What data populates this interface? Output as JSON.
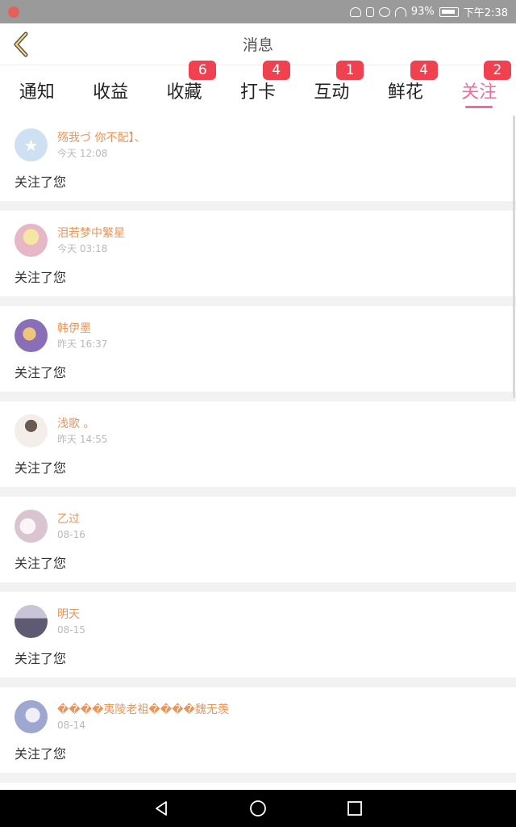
{
  "status": {
    "battery": "93%",
    "time": "下午2:38"
  },
  "header": {
    "title": "消息"
  },
  "tabs": [
    {
      "label": "通知",
      "badge": ""
    },
    {
      "label": "收益",
      "badge": ""
    },
    {
      "label": "收藏",
      "badge": "6"
    },
    {
      "label": "打卡",
      "badge": "4"
    },
    {
      "label": "互动",
      "badge": "1"
    },
    {
      "label": "鲜花",
      "badge": "4"
    },
    {
      "label": "关注",
      "badge": "2",
      "active": true
    }
  ],
  "items": [
    {
      "name": "殇我づ 你不配】、",
      "time": "今天 12:08",
      "action": "关注了您",
      "avatar_color": "#cfe0f3"
    },
    {
      "name": "泪若梦中繁星",
      "time": "今天 03:18",
      "action": "关注了您",
      "avatar_color": "#e7b7c8"
    },
    {
      "name": "韩伊墨",
      "time": "昨天 16:37",
      "action": "关注了您",
      "avatar_color": "#8a6fb8"
    },
    {
      "name": "浅歌 。",
      "time": "昨天 14:55",
      "action": "关注了您",
      "avatar_color": "#d9cfc8"
    },
    {
      "name": "乙过",
      "time": "08-16",
      "action": "关注了您",
      "avatar_color": "#d8c5cf"
    },
    {
      "name": "明天",
      "time": "08-15",
      "action": "关注了您",
      "avatar_color": "#5f5a73"
    },
    {
      "name": "����夷陵老祖����魏无羡",
      "time": "08-14",
      "action": "关注了您",
      "avatar_color": "#9ea7cf"
    }
  ],
  "colors": {
    "accent": "#f26b9a",
    "badge": "#f04150",
    "username": "#e8955b"
  }
}
